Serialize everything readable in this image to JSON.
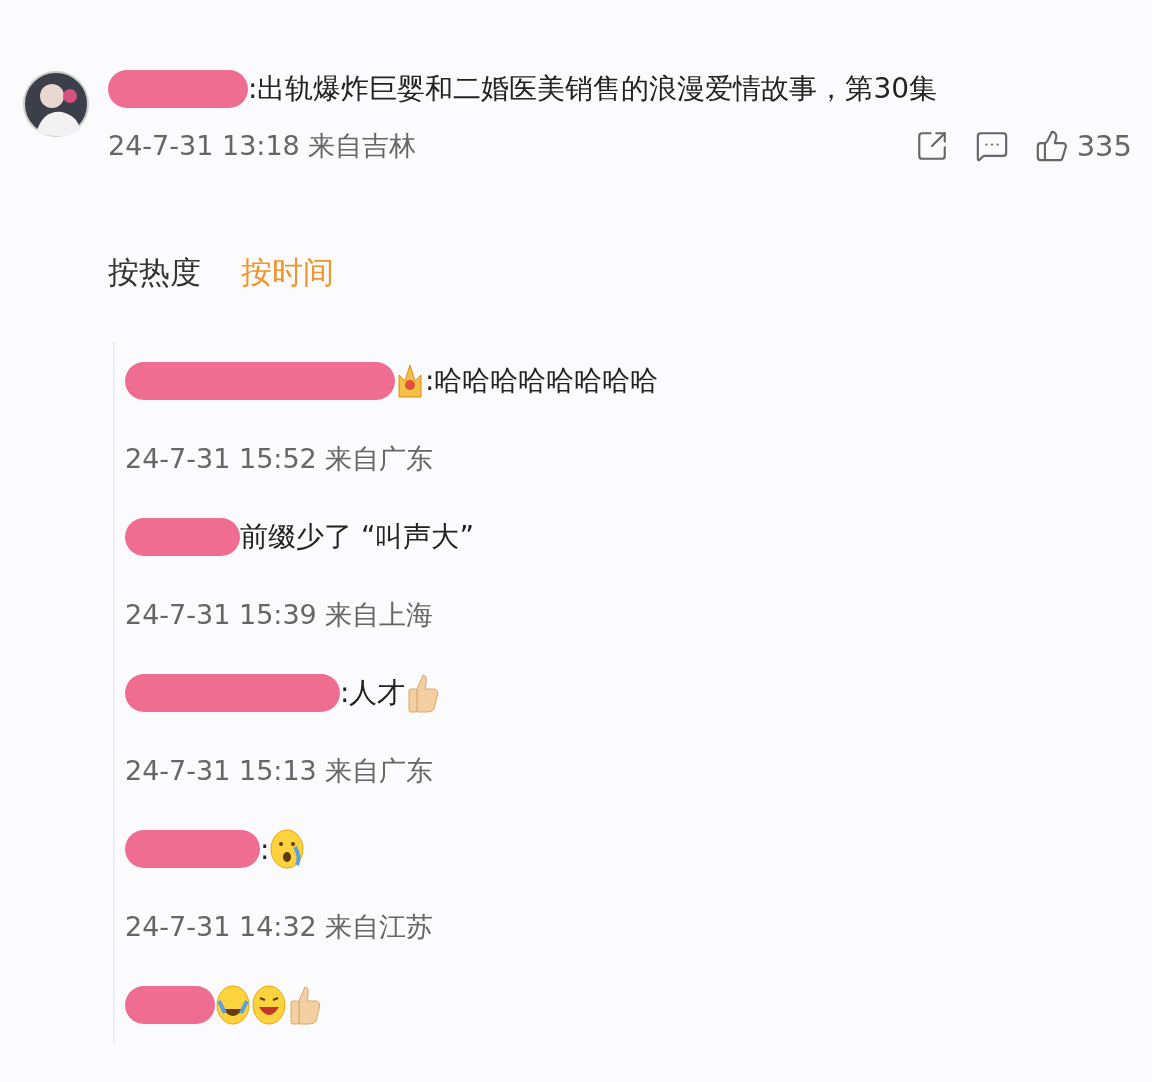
{
  "post": {
    "text": ":出轨爆炸巨婴和二婚医美销售的浪漫爱情故事，第30集",
    "meta": "24-7-31 13:18 来自吉林",
    "likes": "335"
  },
  "sort_tabs": [
    {
      "label": "按热度",
      "selected": false
    },
    {
      "label": "按时间",
      "selected": true
    }
  ],
  "replies": [
    {
      "badge": true,
      "text": ":哈哈哈哈哈哈哈哈",
      "meta": "24-7-31 15:52 来自广东"
    },
    {
      "text": "前缀少了 “叫声大”",
      "meta": "24-7-31 15:39 来自上海"
    },
    {
      "text": ":人才",
      "emojis": [
        {
          "kind": "thumbs"
        }
      ],
      "meta": "24-7-31 15:13 来自广东"
    },
    {
      "text": ":",
      "emojis": [
        {
          "kind": "cry"
        }
      ],
      "meta": "24-7-31 14:32 来自江苏"
    },
    {
      "emojis": [
        {
          "kind": "laughcry"
        },
        {
          "kind": "grin"
        },
        {
          "kind": "thumbs"
        }
      ]
    }
  ]
}
